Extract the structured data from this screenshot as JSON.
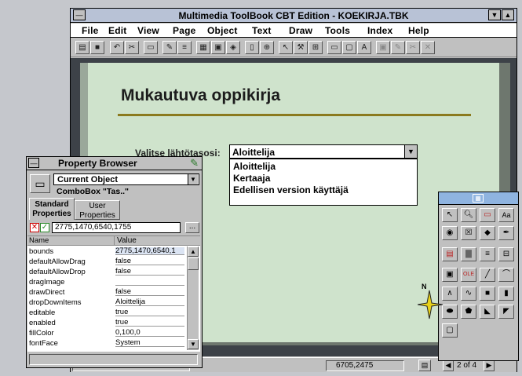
{
  "window": {
    "title": "Multimedia ToolBook CBT Edition - KOEKIRJA.TBK"
  },
  "menu": [
    "File",
    "Edit",
    "View",
    "Page",
    "Object",
    "Text",
    "Draw",
    "Tools",
    "Index",
    "Help"
  ],
  "page": {
    "heading": "Mukautuva oppikirja",
    "prompt": "Valitse lähtötasosi:",
    "combo_value": "Aloittelija",
    "options": [
      "Aloittelija",
      "Kertaaja",
      "Edellisen version käyttäjä"
    ]
  },
  "status": {
    "coords": "6705,2475",
    "page": "2 of 4"
  },
  "property_browser": {
    "title": "Property Browser",
    "object_select": "Current Object",
    "object_name": "ComboBox \"Tas..\"",
    "tabs": {
      "standard": "Standard Properties",
      "user": "User Properties"
    },
    "edit_value": "2775,1470,6540,1755",
    "columns": {
      "name": "Name",
      "value": "Value"
    },
    "rows": [
      {
        "name": "bounds",
        "value": "2775,1470,6540,1"
      },
      {
        "name": "defaultAllowDrag",
        "value": "false"
      },
      {
        "name": "defaultAllowDrop",
        "value": "false"
      },
      {
        "name": "dragImage",
        "value": ""
      },
      {
        "name": "drawDirect",
        "value": "false"
      },
      {
        "name": "dropDownItems",
        "value": "Aloittelija"
      },
      {
        "name": "editable",
        "value": "true"
      },
      {
        "name": "enabled",
        "value": "true"
      },
      {
        "name": "fillColor",
        "value": "0,100,0"
      },
      {
        "name": "fontFace",
        "value": "System"
      }
    ]
  },
  "palette": {
    "north_label": "N"
  }
}
